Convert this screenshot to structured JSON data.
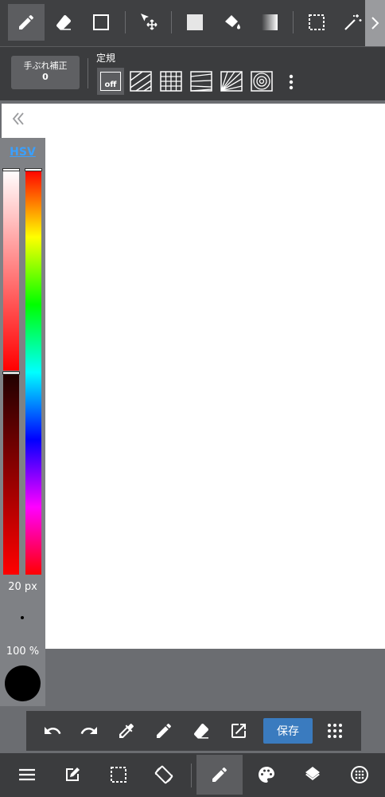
{
  "toolbar": {
    "tools": [
      {
        "name": "pen",
        "icon": "pen-icon",
        "selected": true
      },
      {
        "name": "eraser",
        "icon": "eraser-icon"
      },
      {
        "name": "shape",
        "icon": "square-outline-icon"
      },
      {
        "name": "move",
        "icon": "move-cursor-icon"
      },
      {
        "name": "fill-rect",
        "icon": "filled-square-icon"
      },
      {
        "name": "bucket",
        "icon": "paint-bucket-icon"
      },
      {
        "name": "gradient",
        "icon": "gradient-icon"
      },
      {
        "name": "select",
        "icon": "selection-icon"
      },
      {
        "name": "magic-wand",
        "icon": "magic-wand-icon"
      }
    ],
    "more_icon": "chevron-right-icon"
  },
  "stabilizer": {
    "label": "手ぶれ補正",
    "value": "0"
  },
  "ruler": {
    "label": "定規",
    "off_text": "off",
    "options": [
      "off",
      "parallel",
      "grid",
      "perspective",
      "radial",
      "concentric"
    ]
  },
  "color_panel": {
    "mode_label": "HSV",
    "brush_size": "20 px",
    "opacity": "100 %",
    "current_color": "#000000",
    "hue_color": "#ff0000"
  },
  "quickbar": {
    "save_label": "保存",
    "icons": [
      "undo-icon",
      "redo-icon",
      "eyedropper-icon",
      "pen-icon",
      "eraser-icon",
      "export-icon",
      "grid-dots-icon"
    ]
  },
  "bottombar": {
    "icons": [
      "menu-icon",
      "edit-icon",
      "selection-icon",
      "rotate-icon",
      "pen-icon",
      "palette-icon",
      "layers-icon",
      "brush-settings-icon"
    ]
  },
  "colors": {
    "accent": "#3a7bbf",
    "toolbar_bg": "#3f4042",
    "link": "#3aa0ff"
  }
}
